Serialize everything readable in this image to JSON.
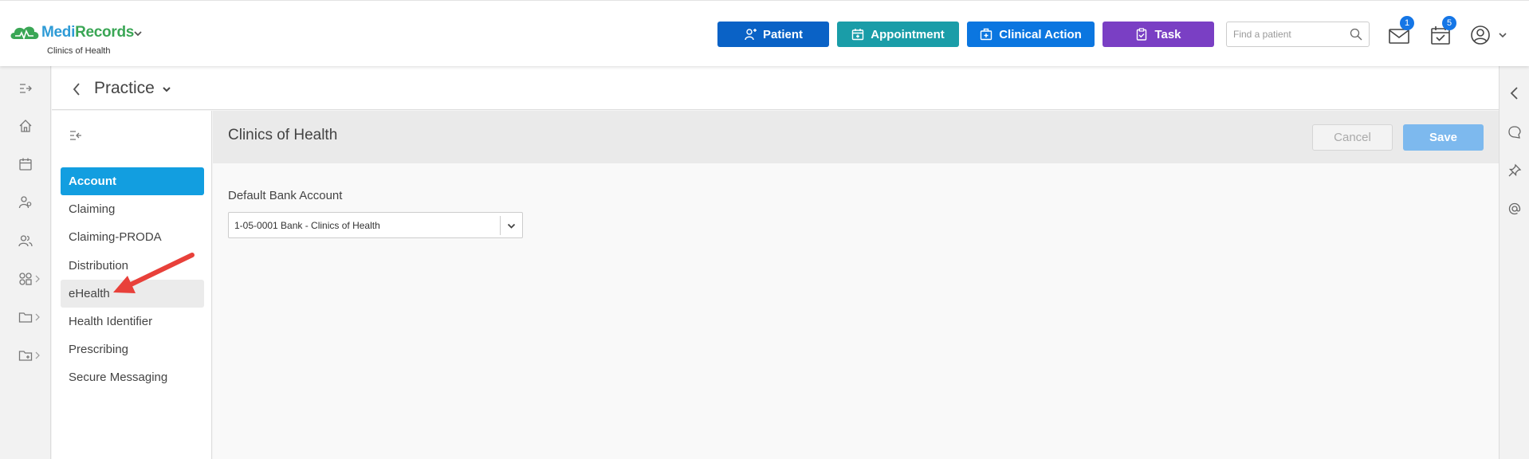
{
  "app": {
    "brand_medi": "Medi",
    "brand_records": "Records",
    "subtitle": "Clinics of Health"
  },
  "header": {
    "buttons": {
      "patient": "Patient",
      "appointment": "Appointment",
      "clinical_action": "Clinical Action",
      "task": "Task"
    },
    "search_placeholder": "Find a patient",
    "messages_badge": "1",
    "tasks_badge": "5"
  },
  "breadcrumb": {
    "title": "Practice"
  },
  "settings_nav": {
    "items": [
      {
        "label": "Account",
        "state": "active"
      },
      {
        "label": "Claiming",
        "state": "normal"
      },
      {
        "label": "Claiming-PRODA",
        "state": "normal"
      },
      {
        "label": "Distribution",
        "state": "normal"
      },
      {
        "label": "eHealth",
        "state": "hover"
      },
      {
        "label": "Health Identifier",
        "state": "normal"
      },
      {
        "label": "Prescribing",
        "state": "normal"
      },
      {
        "label": "Secure Messaging",
        "state": "normal"
      }
    ]
  },
  "content": {
    "title": "Clinics of Health",
    "cancel_label": "Cancel",
    "save_label": "Save",
    "field_label": "Default Bank Account",
    "field_value": "1-05-0001 Bank - Clinics of Health"
  },
  "left_rail": [
    "expand-icon",
    "home-icon",
    "calendar-icon",
    "patients-icon",
    "users-icon",
    "modules-icon",
    "folder-icon",
    "folder-add-icon"
  ],
  "right_rail": [
    "chevron-left-icon",
    "chat-icon",
    "pin-icon",
    "at-icon"
  ],
  "colors": {
    "patient": "#0a62c6",
    "appointment": "#1a9da8",
    "clinical_action": "#0b76e0",
    "task": "#7a3fc4",
    "active_nav": "#129ee0",
    "save": "#7db9ee",
    "annotation_arrow": "#e8403a"
  }
}
